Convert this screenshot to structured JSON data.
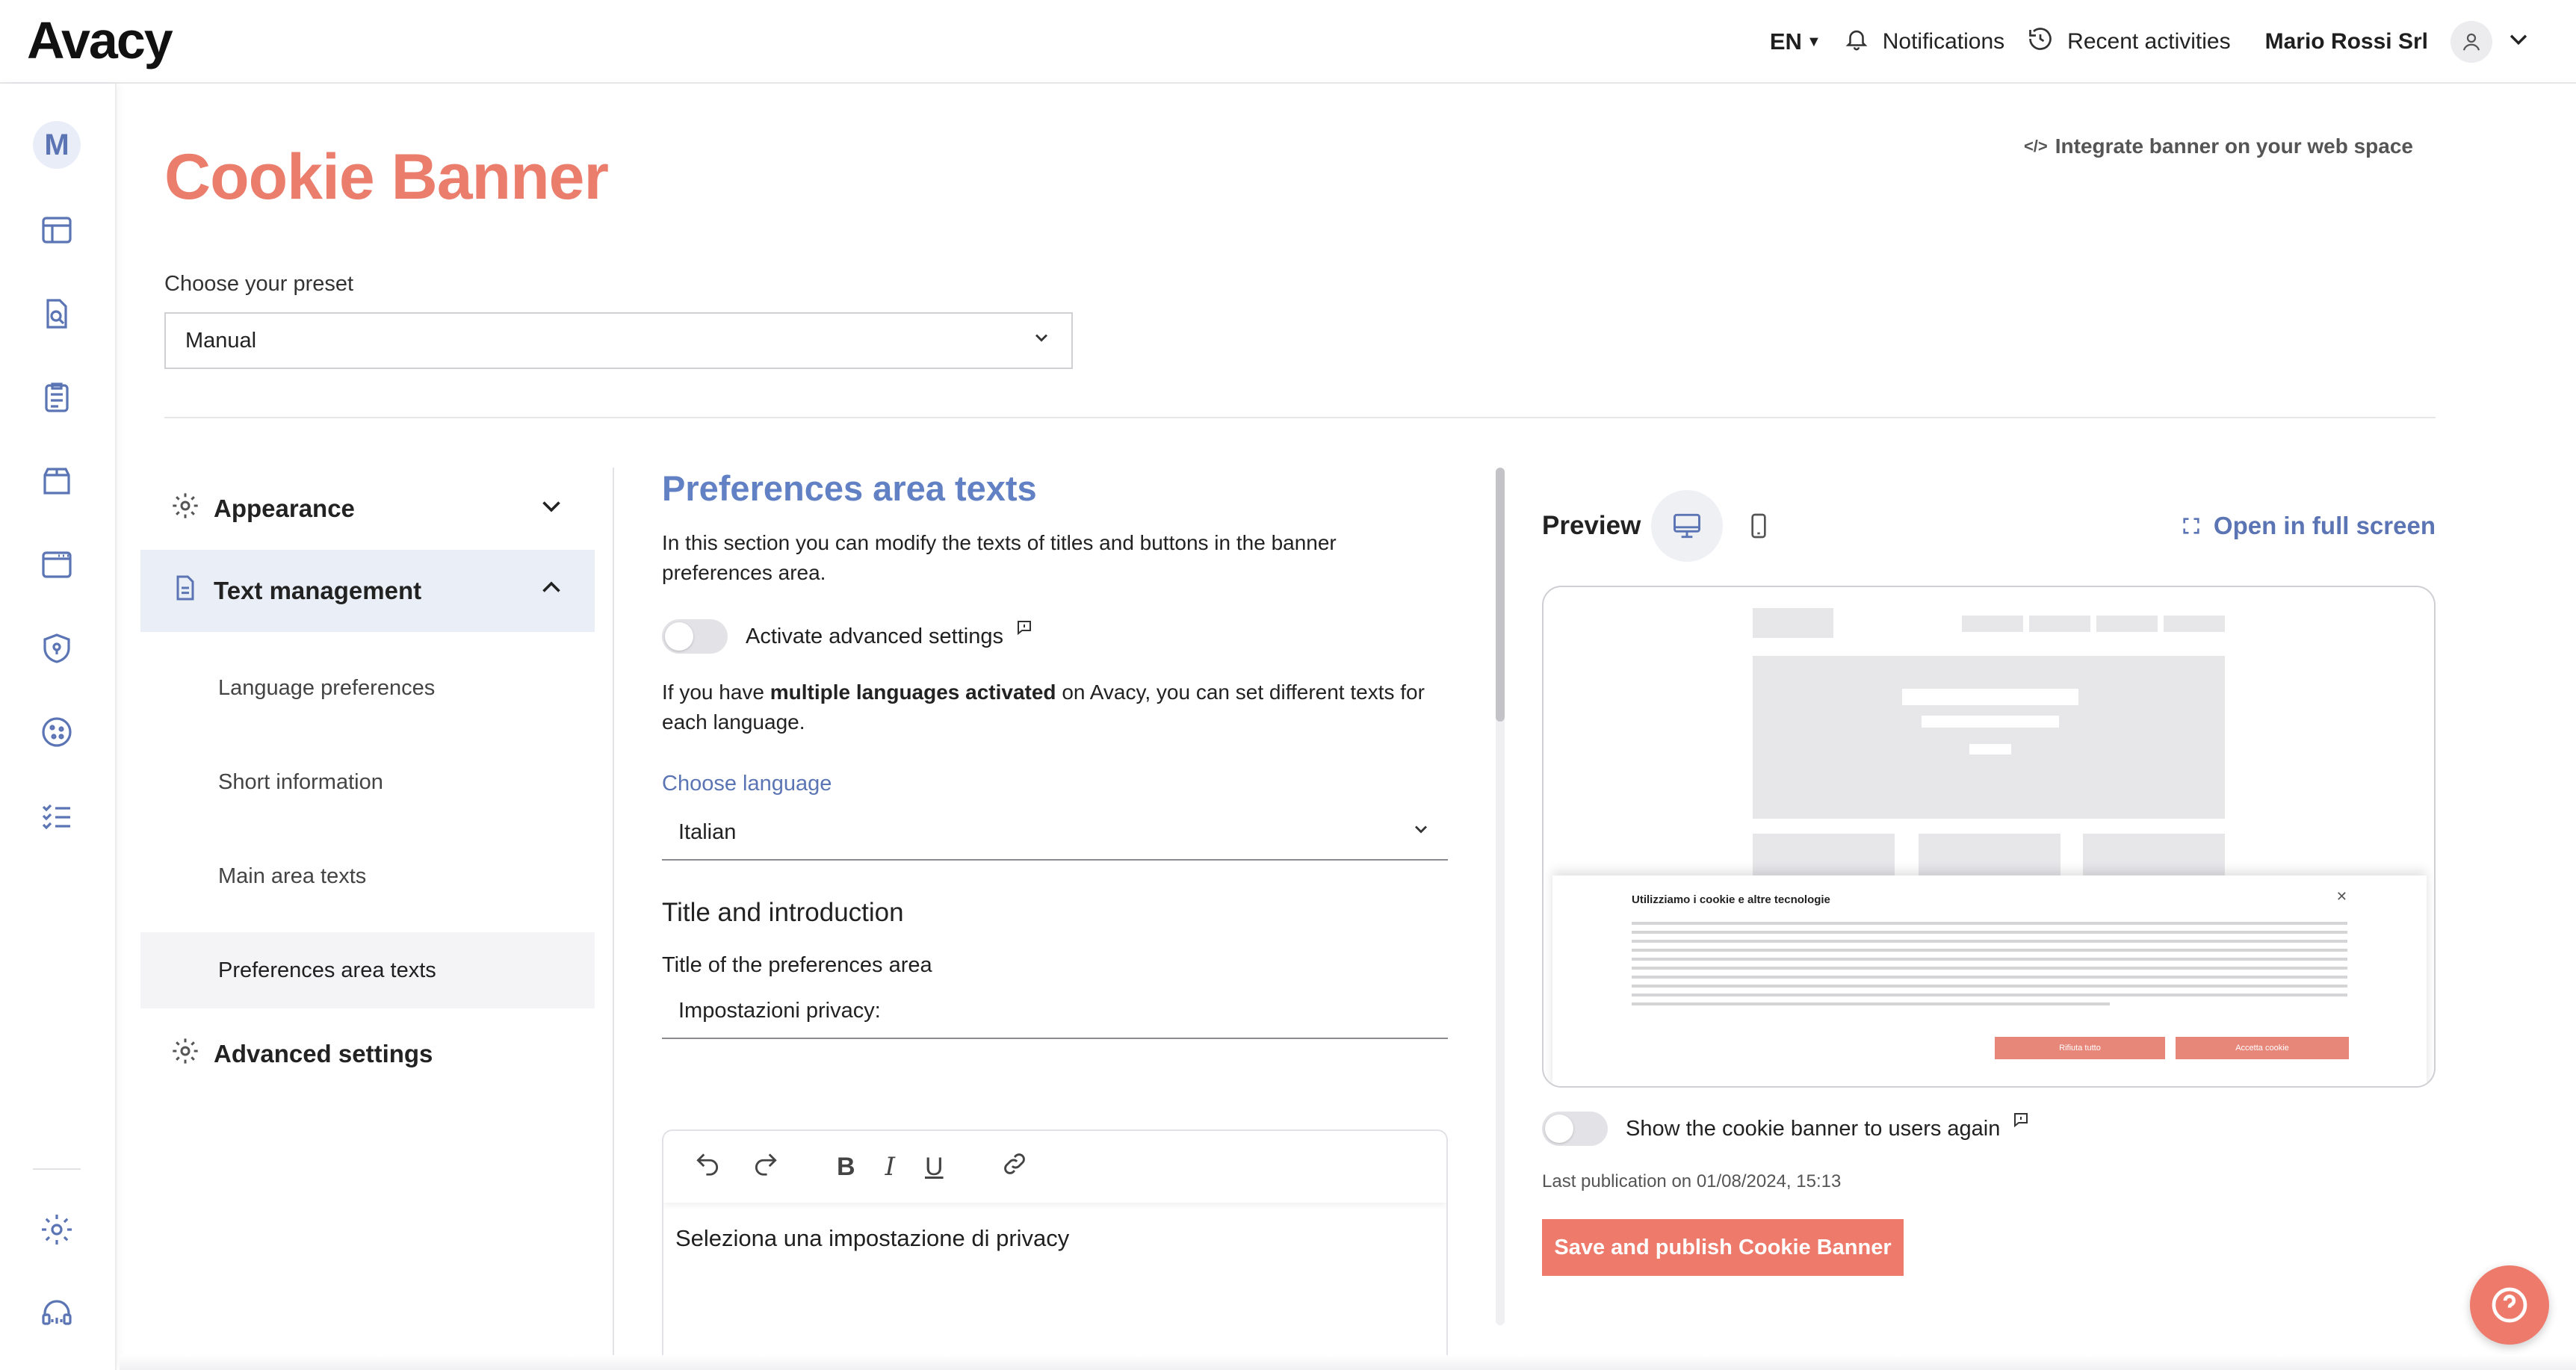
{
  "app": {
    "logo": "Avacy"
  },
  "topbar": {
    "language": "EN",
    "notifications_label": "Notifications",
    "recent_label": "Recent activities",
    "user_name": "Mario Rossi Srl"
  },
  "rail": {
    "avatar_letter": "M"
  },
  "header": {
    "title": "Cookie Banner",
    "integrate_label": "Integrate banner on your web space",
    "preset_label": "Choose your preset",
    "preset_value": "Manual"
  },
  "menu": {
    "appearance": "Appearance",
    "text_management": "Text management",
    "items": [
      {
        "label": "Language preferences"
      },
      {
        "label": "Short information"
      },
      {
        "label": "Main area texts"
      },
      {
        "label": "Preferences area texts"
      }
    ],
    "advanced": "Advanced settings"
  },
  "content": {
    "section_title": "Preferences area texts",
    "intro": "In this section you can modify the texts of titles and buttons in the banner preferences area.",
    "advanced_toggle_label": "Activate advanced settings",
    "multi_lang_prefix": "If you have ",
    "multi_lang_bold": "multiple languages activated",
    "multi_lang_suffix": " on Avacy, you can set different texts for each language.",
    "choose_language_label": "Choose language",
    "language_value": "Italian",
    "title_intro_heading": "Title and introduction",
    "pref_title_label": "Title of the preferences area",
    "pref_title_value": "Impostazioni privacy:",
    "editor_text": "Seleziona una impostazione di privacy"
  },
  "preview": {
    "title": "Preview",
    "fullscreen_label": "Open in full screen",
    "banner_title": "Utilizziamo i cookie e altre tecnologie",
    "banner_reject": "Rifiuta tutto",
    "banner_accept": "Accetta cookie",
    "show_again_label": "Show the cookie banner to users again",
    "last_publication": "Last publication on 01/08/2024, 15:13",
    "save_label": "Save and publish Cookie Banner"
  },
  "colors": {
    "accent": "#ee7a6c",
    "link": "#5b74b4",
    "heading_blue": "#6181c4"
  }
}
